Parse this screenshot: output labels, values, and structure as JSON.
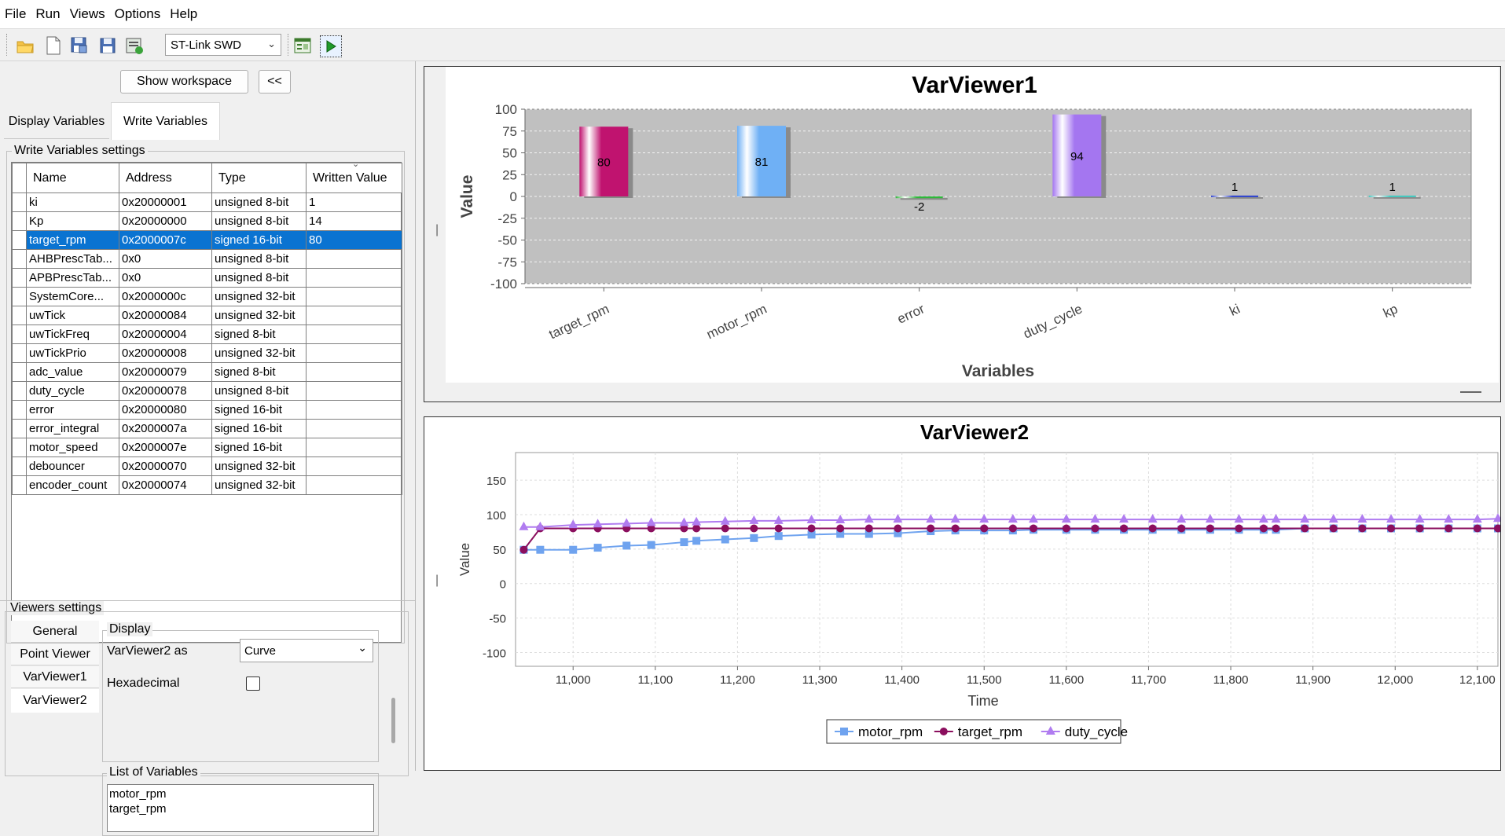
{
  "menu": [
    "File",
    "Run",
    "Views",
    "Options",
    "Help"
  ],
  "toolbar": {
    "icons": [
      "open-folder-icon",
      "new-file-icon",
      "save-as-icon",
      "save-icon",
      "export-icon"
    ],
    "probe": "ST-Link SWD",
    "extra_icons": [
      "workspace-layout-icon",
      "run-icon"
    ]
  },
  "left": {
    "show_workspace": "Show workspace",
    "collapse": "<<",
    "tabs": [
      "Display Variables",
      "Write Variables"
    ],
    "active_tab": "Write Variables",
    "write_group_title": "Write Variables settings",
    "columns": [
      "Name",
      "Address",
      "Type",
      "Written Value"
    ],
    "rows": [
      {
        "name": "ki",
        "address": "0x20000001",
        "type": "unsigned 8-bit",
        "value": "1"
      },
      {
        "name": "Kp",
        "address": "0x20000000",
        "type": "unsigned 8-bit",
        "value": "14"
      },
      {
        "name": "target_rpm",
        "address": "0x2000007c",
        "type": "signed 16-bit",
        "value": "80"
      },
      {
        "name": "AHBPrescTab...",
        "address": "0x0",
        "type": "unsigned 8-bit",
        "value": ""
      },
      {
        "name": "APBPrescTab...",
        "address": "0x0",
        "type": "unsigned 8-bit",
        "value": ""
      },
      {
        "name": "SystemCore...",
        "address": "0x2000000c",
        "type": "unsigned 32-bit",
        "value": ""
      },
      {
        "name": "uwTick",
        "address": "0x20000084",
        "type": "unsigned 32-bit",
        "value": ""
      },
      {
        "name": "uwTickFreq",
        "address": "0x20000004",
        "type": "signed 8-bit",
        "value": ""
      },
      {
        "name": "uwTickPrio",
        "address": "0x20000008",
        "type": "unsigned 32-bit",
        "value": ""
      },
      {
        "name": "adc_value",
        "address": "0x20000079",
        "type": "signed 8-bit",
        "value": ""
      },
      {
        "name": "duty_cycle",
        "address": "0x20000078",
        "type": "unsigned 8-bit",
        "value": ""
      },
      {
        "name": "error",
        "address": "0x20000080",
        "type": "signed 16-bit",
        "value": ""
      },
      {
        "name": "error_integral",
        "address": "0x2000007a",
        "type": "signed 16-bit",
        "value": ""
      },
      {
        "name": "motor_speed",
        "address": "0x2000007e",
        "type": "signed 16-bit",
        "value": ""
      },
      {
        "name": "debouncer",
        "address": "0x20000070",
        "type": "unsigned 32-bit",
        "value": ""
      },
      {
        "name": "encoder_count",
        "address": "0x20000074",
        "type": "unsigned 32-bit",
        "value": ""
      }
    ],
    "selected_row": "target_rpm",
    "viewers_title": "Viewers settings",
    "viewer_tabs": [
      "General",
      "Point Viewer",
      "VarViewer1",
      "VarViewer2"
    ],
    "active_viewer_tab": "VarViewer2",
    "display_title": "Display",
    "display_as_label": "VarViewer2 as",
    "display_as_value": "Curve",
    "hex_label": "Hexadecimal",
    "hex_checked": false,
    "list_title": "List of Variables",
    "list_items": [
      "motor_rpm",
      "target_rpm"
    ]
  },
  "chart_data": [
    {
      "type": "bar",
      "title": "VarViewer1",
      "xlabel": "Variables",
      "ylabel": "Value",
      "ylim": [
        -100,
        100
      ],
      "yticks": [
        100,
        75,
        50,
        25,
        0,
        -25,
        -50,
        -75,
        -100
      ],
      "categories": [
        "target_rpm",
        "motor_rpm",
        "error",
        "duty_cycle",
        "ki",
        "kp"
      ],
      "values": [
        80,
        81,
        -2,
        94,
        1,
        1
      ],
      "labels": [
        "80",
        "81",
        "-2",
        "94",
        "1",
        "1"
      ],
      "colors": [
        "#c0136f",
        "#6fb0f5",
        "#2eb83a",
        "#a476f0",
        "#2a3fd0",
        "#3ec9c0"
      ]
    },
    {
      "type": "line",
      "title": "VarViewer2",
      "xlabel": "Time",
      "ylabel": "Value",
      "xlim": [
        10930,
        12125
      ],
      "ylim": [
        -120,
        190
      ],
      "xticks": [
        "11,000",
        "11,100",
        "11,200",
        "11,300",
        "11,400",
        "11,500",
        "11,600",
        "11,700",
        "11,800",
        "11,900",
        "12,000",
        "12,100"
      ],
      "yticks": [
        150,
        100,
        50,
        0,
        -50,
        -100
      ],
      "x": [
        10940,
        10960,
        11000,
        11030,
        11065,
        11095,
        11135,
        11150,
        11185,
        11220,
        11250,
        11290,
        11325,
        11360,
        11395,
        11435,
        11465,
        11500,
        11535,
        11560,
        11600,
        11635,
        11670,
        11705,
        11740,
        11775,
        11810,
        11840,
        11855,
        11890,
        11925,
        11960,
        11995,
        12030,
        12065,
        12100,
        12125
      ],
      "series": [
        {
          "name": "motor_rpm",
          "color": "#6fa3ef",
          "marker": "square",
          "values": [
            49,
            49,
            49,
            52,
            55,
            56,
            60,
            62,
            64,
            66,
            69,
            71,
            72,
            72,
            73,
            76,
            77,
            77,
            77,
            78,
            78,
            78,
            78,
            78,
            78,
            78,
            78,
            78,
            78,
            80,
            80,
            80,
            80,
            80,
            80,
            80,
            80
          ]
        },
        {
          "name": "target_rpm",
          "color": "#8b0f5e",
          "marker": "circle",
          "values": [
            49,
            80,
            80,
            80,
            80,
            80,
            80,
            80,
            80,
            80,
            80,
            80,
            80,
            80,
            80,
            80,
            80,
            80,
            80,
            80,
            80,
            80,
            80,
            80,
            80,
            80,
            80,
            80,
            80,
            80,
            80,
            80,
            80,
            80,
            80,
            80,
            80
          ]
        },
        {
          "name": "duty_cycle",
          "color": "#b07cf0",
          "marker": "triangle",
          "values": [
            82,
            82,
            85,
            86,
            87,
            88,
            88,
            89,
            90,
            91,
            91,
            92,
            92,
            93,
            93,
            93,
            93,
            93,
            93,
            93,
            93,
            93,
            93,
            93,
            93,
            93,
            93,
            93,
            93,
            93,
            93,
            93,
            93,
            93,
            93,
            93,
            94
          ]
        }
      ]
    }
  ]
}
